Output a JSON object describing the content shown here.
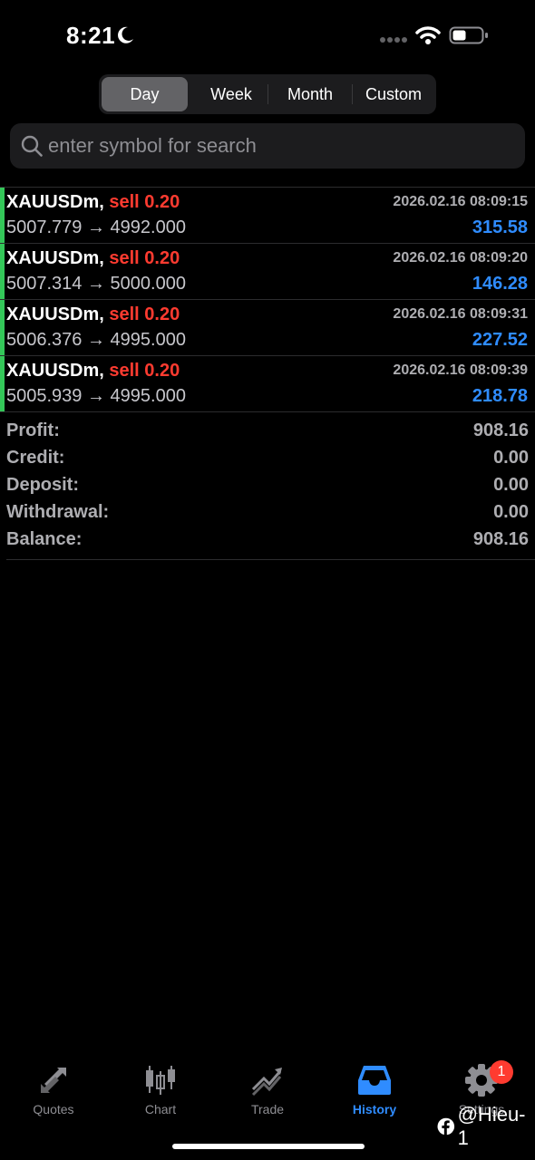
{
  "status_bar": {
    "time": "8:21"
  },
  "periods": {
    "items": [
      "Day",
      "Week",
      "Month",
      "Custom"
    ],
    "selected": "Day"
  },
  "search": {
    "placeholder": "enter symbol for search"
  },
  "deals": [
    {
      "symbol": "XAUUSDm,",
      "type": "sell 0.20",
      "open_price": "5007.779",
      "close_price": "4992.000",
      "time": "2026.02.16 08:09:15",
      "profit": "315.58"
    },
    {
      "symbol": "XAUUSDm,",
      "type": "sell 0.20",
      "open_price": "5007.314",
      "close_price": "5000.000",
      "time": "2026.02.16 08:09:20",
      "profit": "146.28"
    },
    {
      "symbol": "XAUUSDm,",
      "type": "sell 0.20",
      "open_price": "5006.376",
      "close_price": "4995.000",
      "time": "2026.02.16 08:09:31",
      "profit": "227.52"
    },
    {
      "symbol": "XAUUSDm,",
      "type": "sell 0.20",
      "open_price": "5005.939",
      "close_price": "4995.000",
      "time": "2026.02.16 08:09:39",
      "profit": "218.78"
    }
  ],
  "arrow": "→",
  "summary": [
    {
      "label": "Profit:",
      "value": "908.16"
    },
    {
      "label": "Credit:",
      "value": "0.00"
    },
    {
      "label": "Deposit:",
      "value": "0.00"
    },
    {
      "label": "Withdrawal:",
      "value": "0.00"
    },
    {
      "label": "Balance:",
      "value": "908.16"
    }
  ],
  "tabs": [
    {
      "label": "Quotes",
      "icon": "quotes-icon"
    },
    {
      "label": "Chart",
      "icon": "candlestick-chart-icon"
    },
    {
      "label": "Trade",
      "icon": "trade-icon"
    },
    {
      "label": "History",
      "icon": "inbox-history-icon"
    },
    {
      "label": "Settings",
      "icon": "gear-icon"
    }
  ],
  "active_tab": "History",
  "settings_badge": "1",
  "watermark": "@Hieu-1",
  "colors": {
    "sell": "#ff3b30",
    "profit": "#2f8cff",
    "deal_bar": "#34c759",
    "active_tab": "#2f8cff",
    "badge": "#ff3b30"
  }
}
